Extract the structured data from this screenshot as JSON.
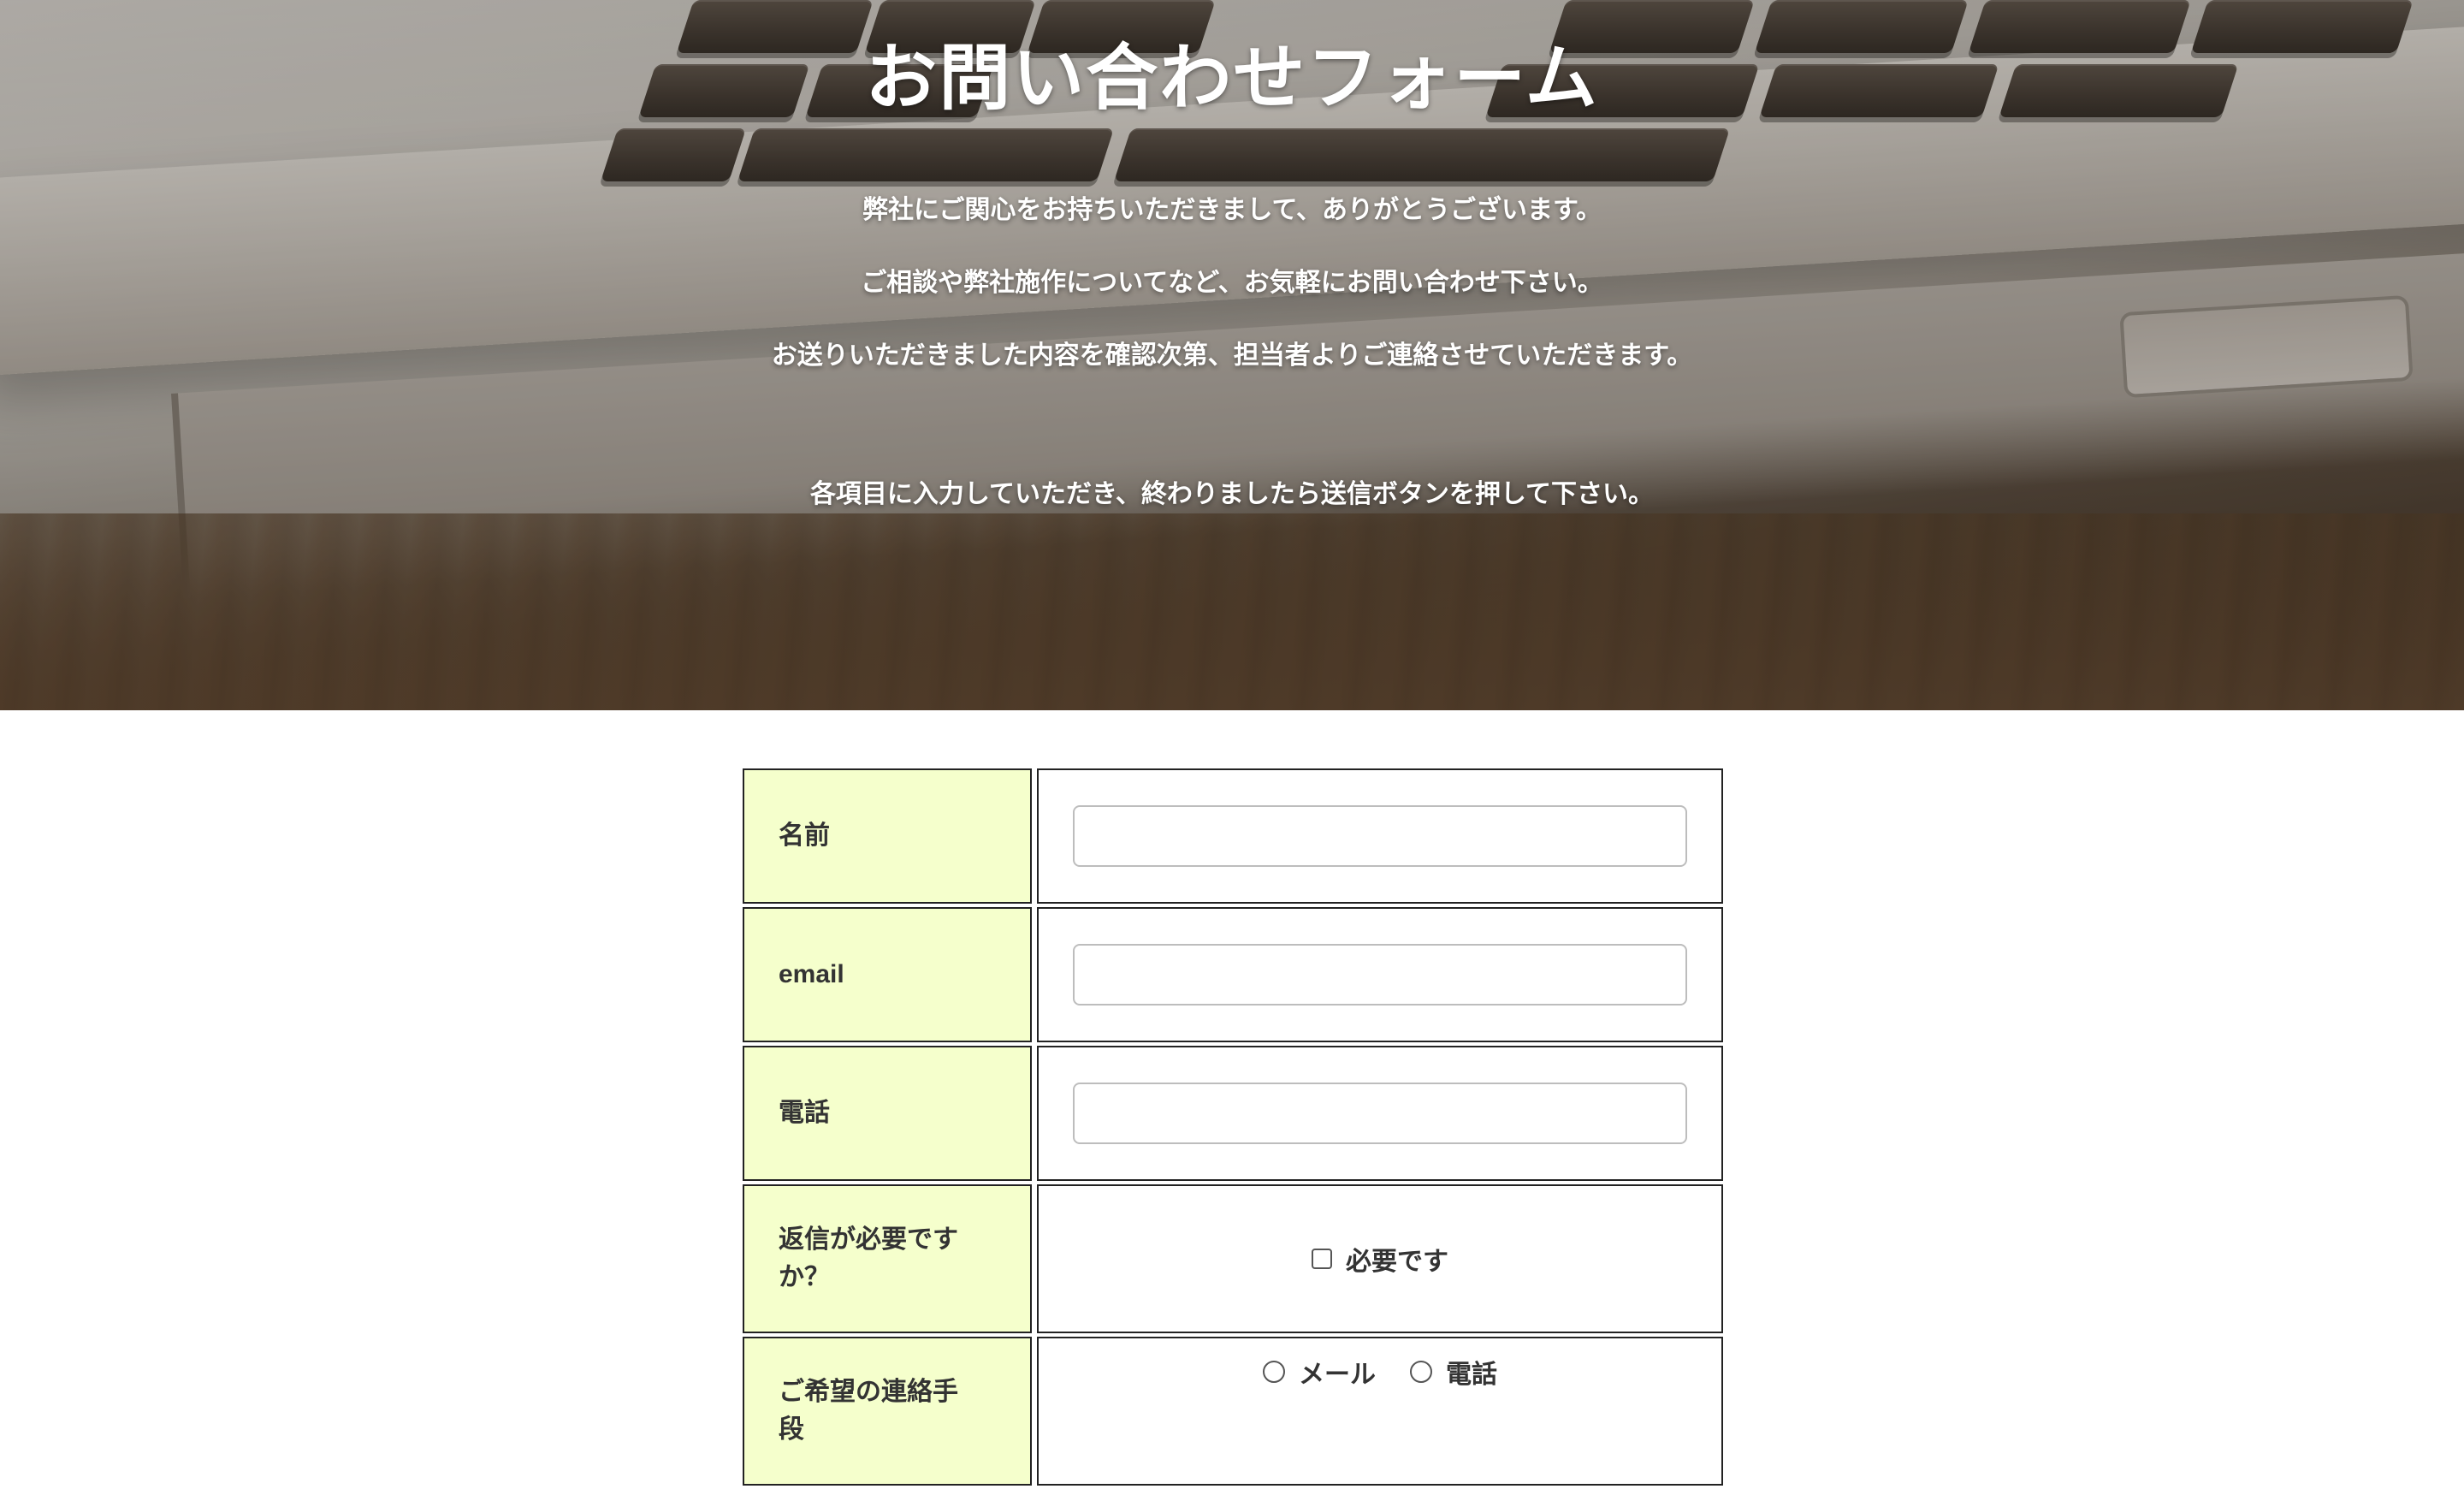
{
  "hero": {
    "title": "お問い合わせフォーム",
    "lines": [
      "弊社にご関心をお持ちいただきまして、ありがとうございます。",
      "ご相談や弊社施作についてなど、お気軽にお問い合わせ下さい。",
      "お送りいただきました内容を確認次第、担当者よりご連絡させていただきます。",
      "各項目に入力していただき、終わりましたら送信ボタンを押して下さい。"
    ]
  },
  "form": {
    "name": {
      "label": "名前",
      "value": ""
    },
    "email": {
      "label": "email",
      "value": ""
    },
    "phone": {
      "label": "電話",
      "value": ""
    },
    "reply": {
      "label": "返信が必要ですか？",
      "option": "必要です",
      "checked": false
    },
    "contact_method": {
      "label": "ご希望の連絡手段",
      "options": [
        "メール",
        "電話"
      ],
      "selected": ""
    }
  },
  "colors": {
    "label_bg": "#f5ffcc",
    "border": "#222222"
  }
}
